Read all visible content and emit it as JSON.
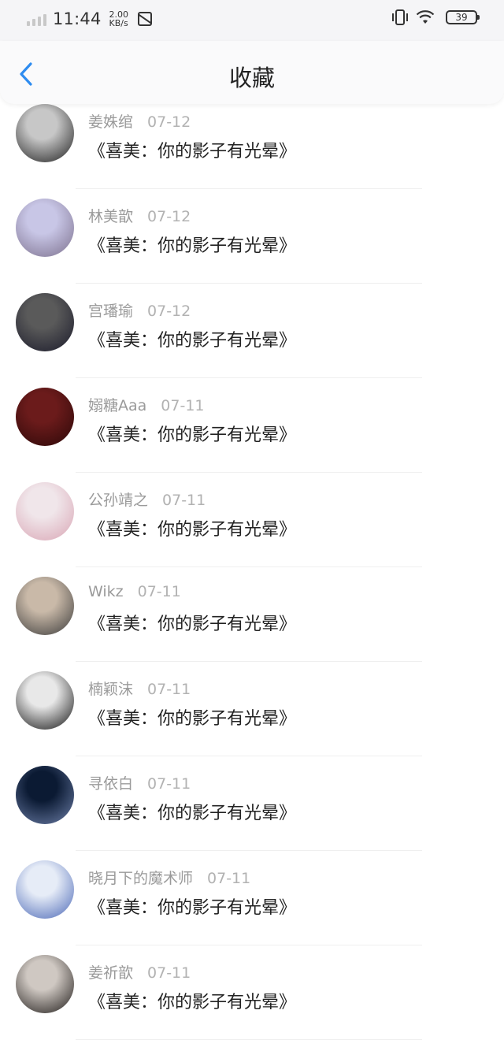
{
  "status_bar": {
    "time": "11:44",
    "speed_value": "2.00",
    "speed_unit": "KB/s",
    "battery": "39"
  },
  "header": {
    "title": "收藏",
    "back_icon": "chevron-left-icon",
    "accent": "#2e8cf0"
  },
  "favorites": [
    {
      "name": "姜姝绾",
      "date": "07-12",
      "title": "《喜美：你的影子有光晕》",
      "avatar_colors": [
        "#c7c7c7",
        "#1e1e1e"
      ]
    },
    {
      "name": "林美歆",
      "date": "07-12",
      "title": "《喜美：你的影子有光晕》",
      "avatar_colors": [
        "#c8c6e6",
        "#7b6f8c"
      ]
    },
    {
      "name": "宫璠瑜",
      "date": "07-12",
      "title": "《喜美：你的影子有光晕》",
      "avatar_colors": [
        "#5a5a5a",
        "#1a1a2a"
      ]
    },
    {
      "name": "嫋糖Aaa",
      "date": "07-11",
      "title": "《喜美：你的影子有光晕》",
      "avatar_colors": [
        "#6b1b1b",
        "#2b0808"
      ]
    },
    {
      "name": "公孙靖之",
      "date": "07-11",
      "title": "《喜美：你的影子有光晕》",
      "avatar_colors": [
        "#f0e6ea",
        "#d9a5b4"
      ]
    },
    {
      "name": "Wikz",
      "date": "07-11",
      "title": "《喜美：你的影子有光晕》",
      "avatar_colors": [
        "#c9b9a8",
        "#3a3a3a"
      ]
    },
    {
      "name": "楠颖沫",
      "date": "07-11",
      "title": "《喜美：你的影子有光晕》",
      "avatar_colors": [
        "#e8e8e8",
        "#111111"
      ]
    },
    {
      "name": "寻依白",
      "date": "07-11",
      "title": "《喜美：你的影子有光晕》",
      "avatar_colors": [
        "#0b1a33",
        "#6d7fa8"
      ]
    },
    {
      "name": "晓月下的魔术师",
      "date": "07-11",
      "title": "《喜美：你的影子有光晕》",
      "avatar_colors": [
        "#e6ecf7",
        "#4a67b6"
      ]
    },
    {
      "name": "姜祈歆",
      "date": "07-11",
      "title": "《喜美：你的影子有光晕》",
      "avatar_colors": [
        "#cfc8c2",
        "#1e1a18"
      ]
    }
  ]
}
